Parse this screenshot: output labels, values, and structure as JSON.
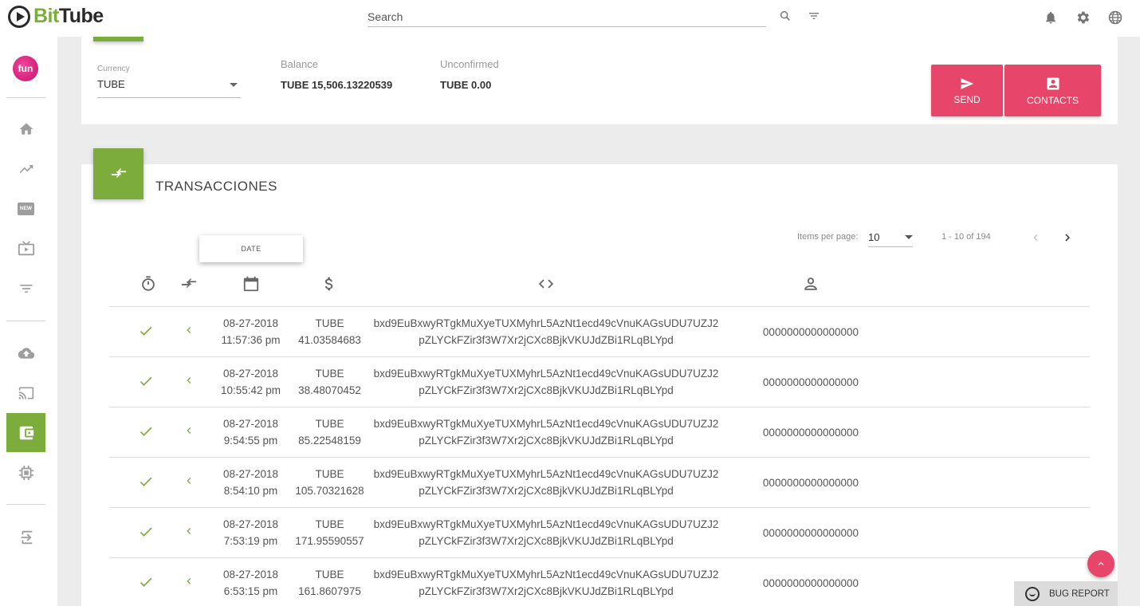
{
  "app": {
    "logo_bit": "Bit",
    "logo_tube": "Tube"
  },
  "search": {
    "placeholder": "Search"
  },
  "sidebar": {
    "avatar_text": "fun",
    "items": [
      {
        "name": "home",
        "icon": "home-icon"
      },
      {
        "name": "trending",
        "icon": "trending-up-icon"
      },
      {
        "name": "new",
        "icon": "new-badge-icon",
        "label": "NEW"
      },
      {
        "name": "subscriptions",
        "icon": "tv-icon"
      },
      {
        "name": "filter",
        "icon": "filter-list-icon"
      },
      {
        "name": "upload",
        "icon": "cloud-upload-icon"
      },
      {
        "name": "cast",
        "icon": "cast-icon"
      },
      {
        "name": "wallet",
        "icon": "wallet-icon",
        "active": true
      },
      {
        "name": "mining",
        "icon": "chip-icon"
      },
      {
        "name": "logout",
        "icon": "logout-icon"
      }
    ]
  },
  "wallet": {
    "currency_label": "Currency",
    "currency_value": "TUBE",
    "balance_label": "Balance",
    "balance_value": "TUBE 15,506.13220539",
    "unconfirmed_label": "Unconfirmed",
    "unconfirmed_value": "TUBE 0.00",
    "send_label": "SEND",
    "contacts_label": "CONTACTS"
  },
  "transactions": {
    "title": "TRANSACCIONES",
    "tooltip": "DATE",
    "items_per_page_label": "Items per page:",
    "items_per_page_value": "10",
    "range_label": "1 - 10 of 194",
    "columns": [
      "status-icon",
      "direction-icon",
      "calendar-icon",
      "dollar-icon",
      "code-icon",
      "person-icon"
    ],
    "rows": [
      {
        "date": "08-27-2018",
        "time": "11:57:36 pm",
        "currency": "TUBE",
        "amount": "41.03584683",
        "addr1": "bxd9EuBxwyRTgkMuXyeTUXMyhrL5AzNt1ecd49cVnuKAGsUDU7UZJ2",
        "addr2": "pZLYCkFZir3f3W7Xr2jCXc8BjkVKUJdZBi1RLqBLYpd",
        "payment_id": "0000000000000000"
      },
      {
        "date": "08-27-2018",
        "time": "10:55:42 pm",
        "currency": "TUBE",
        "amount": "38.48070452",
        "addr1": "bxd9EuBxwyRTgkMuXyeTUXMyhrL5AzNt1ecd49cVnuKAGsUDU7UZJ2",
        "addr2": "pZLYCkFZir3f3W7Xr2jCXc8BjkVKUJdZBi1RLqBLYpd",
        "payment_id": "0000000000000000"
      },
      {
        "date": "08-27-2018",
        "time": "9:54:55 pm",
        "currency": "TUBE",
        "amount": "85.22548159",
        "addr1": "bxd9EuBxwyRTgkMuXyeTUXMyhrL5AzNt1ecd49cVnuKAGsUDU7UZJ2",
        "addr2": "pZLYCkFZir3f3W7Xr2jCXc8BjkVKUJdZBi1RLqBLYpd",
        "payment_id": "0000000000000000"
      },
      {
        "date": "08-27-2018",
        "time": "8:54:10 pm",
        "currency": "TUBE",
        "amount": "105.70321628",
        "addr1": "bxd9EuBxwyRTgkMuXyeTUXMyhrL5AzNt1ecd49cVnuKAGsUDU7UZJ2",
        "addr2": "pZLYCkFZir3f3W7Xr2jCXc8BjkVKUJdZBi1RLqBLYpd",
        "payment_id": "0000000000000000"
      },
      {
        "date": "08-27-2018",
        "time": "7:53:19 pm",
        "currency": "TUBE",
        "amount": "171.95590557",
        "addr1": "bxd9EuBxwyRTgkMuXyeTUXMyhrL5AzNt1ecd49cVnuKAGsUDU7UZJ2",
        "addr2": "pZLYCkFZir3f3W7Xr2jCXc8BjkVKUJdZBi1RLqBLYpd",
        "payment_id": "0000000000000000"
      },
      {
        "date": "08-27-2018",
        "time": "6:53:15 pm",
        "currency": "TUBE",
        "amount": "161.8607975",
        "addr1": "bxd9EuBxwyRTgkMuXyeTUXMyhrL5AzNt1ecd49cVnuKAGsUDU7UZJ2",
        "addr2": "pZLYCkFZir3f3W7Xr2jCXc8BjkVKUJdZBi1RLqBLYpd",
        "payment_id": "0000000000000000"
      }
    ]
  },
  "bug_report": {
    "label": "BUG REPORT"
  },
  "colors": {
    "brand_green": "#7cac3c",
    "accent_pink": "#e8456b",
    "background": "#ececec"
  }
}
